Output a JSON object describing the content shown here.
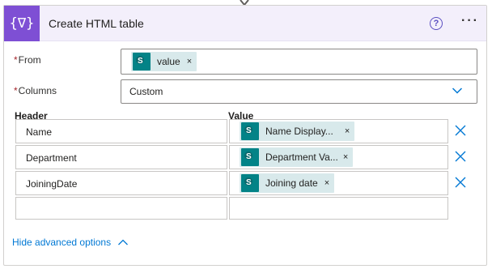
{
  "header": {
    "icon_glyph": "{∇}",
    "title": "Create HTML table",
    "help_glyph": "?",
    "more_glyph": "···",
    "accent_color": "#7e4fd4"
  },
  "from_field": {
    "label": "From",
    "required_mark": "*",
    "token": {
      "label": "value",
      "icon": "sharepoint-icon",
      "remove_glyph": "×"
    }
  },
  "columns_field": {
    "label": "Columns",
    "required_mark": "*",
    "selected": "Custom"
  },
  "table": {
    "header_label": "Header",
    "value_label": "Value",
    "rows": [
      {
        "header": "Name",
        "value": "Name Display...",
        "remove_glyph": "×"
      },
      {
        "header": "Department",
        "value": "Department Va...",
        "remove_glyph": "×"
      },
      {
        "header": "JoiningDate",
        "value": "Joining date",
        "remove_glyph": "×"
      },
      {
        "header": "",
        "value": ""
      }
    ]
  },
  "advanced_link": "Hide advanced options",
  "link_color": "#0078d4"
}
